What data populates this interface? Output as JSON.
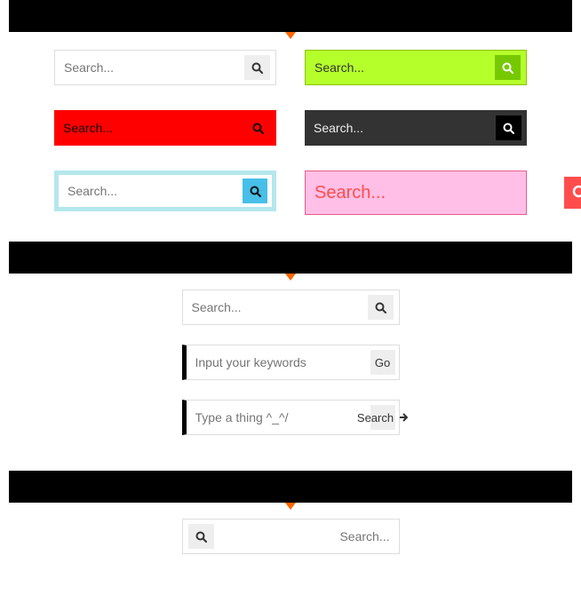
{
  "placeholder": "Search...",
  "section2": {
    "box1_placeholder": "Search...",
    "box2_placeholder": "Input your keywords",
    "box2_button": "Go",
    "box3_placeholder": "Type a thing ^_^/",
    "box3_button": "Search"
  },
  "section3": {
    "placeholder": "Search..."
  }
}
